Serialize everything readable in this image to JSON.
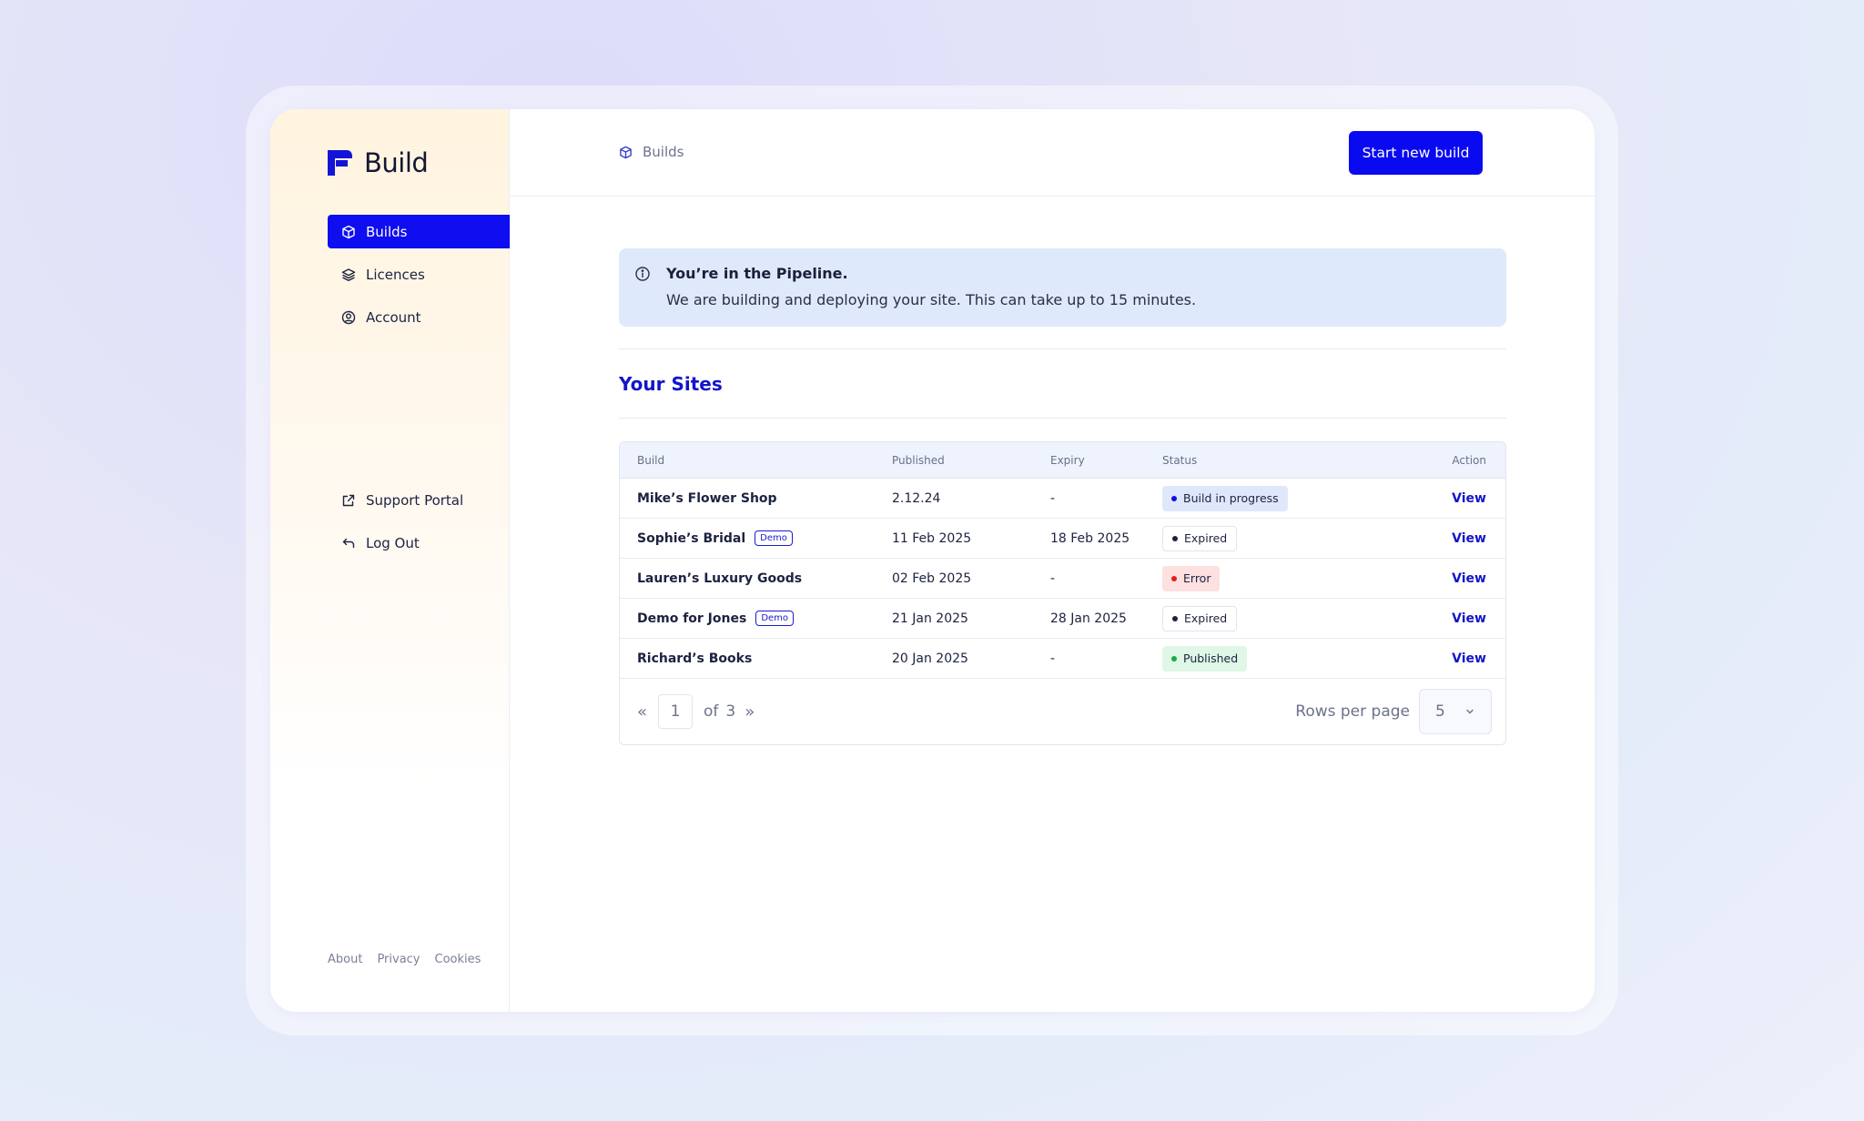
{
  "app": {
    "name": "Build"
  },
  "sidebar": {
    "items": [
      {
        "label": "Builds",
        "icon": "cube-icon",
        "active": true
      },
      {
        "label": "Licences",
        "icon": "layers-icon"
      },
      {
        "label": "Account",
        "icon": "user-circle-icon"
      }
    ],
    "secondary": [
      {
        "label": "Support Portal",
        "icon": "external-link-icon"
      },
      {
        "label": "Log Out",
        "icon": "undo-arrow-icon"
      }
    ],
    "footer": [
      "About",
      "Privacy",
      "Cookies"
    ]
  },
  "header": {
    "breadcrumb": "Builds",
    "primary_button": "Start new build"
  },
  "alert": {
    "title": "You’re in the Pipeline.",
    "body": "We are building and deploying your site. This can take up to 15 minutes."
  },
  "sites": {
    "title": "Your Sites",
    "columns": [
      "Build",
      "Published",
      "Expiry",
      "Status",
      "Action"
    ],
    "rows": [
      {
        "build": "Mike’s Flower Shop",
        "demo": "",
        "published": "2.12.24",
        "expiry": "-",
        "status": "Build in progress",
        "status_bg": "#dfe8fb",
        "status_dot": "#1010e0",
        "action": "View"
      },
      {
        "build": "Sophie’s Bridal",
        "demo": "Demo",
        "published": "11 Feb 2025",
        "expiry": "18 Feb 2025",
        "status": "Expired",
        "status_bg": "#ffffff",
        "status_dot": "#1d2240",
        "action": "View"
      },
      {
        "build": "Lauren’s Luxury Goods",
        "demo": "",
        "published": "02 Feb 2025",
        "expiry": "-",
        "status": "Error",
        "status_bg": "#fde0e0",
        "status_dot": "#e02020",
        "action": "View"
      },
      {
        "build": "Demo for Jones",
        "demo": "Demo",
        "published": "21 Jan 2025",
        "expiry": "28 Jan 2025",
        "status": "Expired",
        "status_bg": "#ffffff",
        "status_dot": "#1d2240",
        "action": "View"
      },
      {
        "build": "Richard’s Books",
        "demo": "",
        "published": "20 Jan 2025",
        "expiry": "-",
        "status": "Published",
        "status_bg": "#dff7e6",
        "status_dot": "#1aa84a",
        "action": "View"
      }
    ],
    "pagination": {
      "prev": "«",
      "current": "1",
      "of_label": "of",
      "total": "3",
      "next": "»",
      "rows_per_page_label": "Rows per page",
      "rows_per_page": "5"
    }
  },
  "colors": {
    "accent": "#0a0af0",
    "link": "#1414c8",
    "alert_bg": "#dfe9fc"
  }
}
